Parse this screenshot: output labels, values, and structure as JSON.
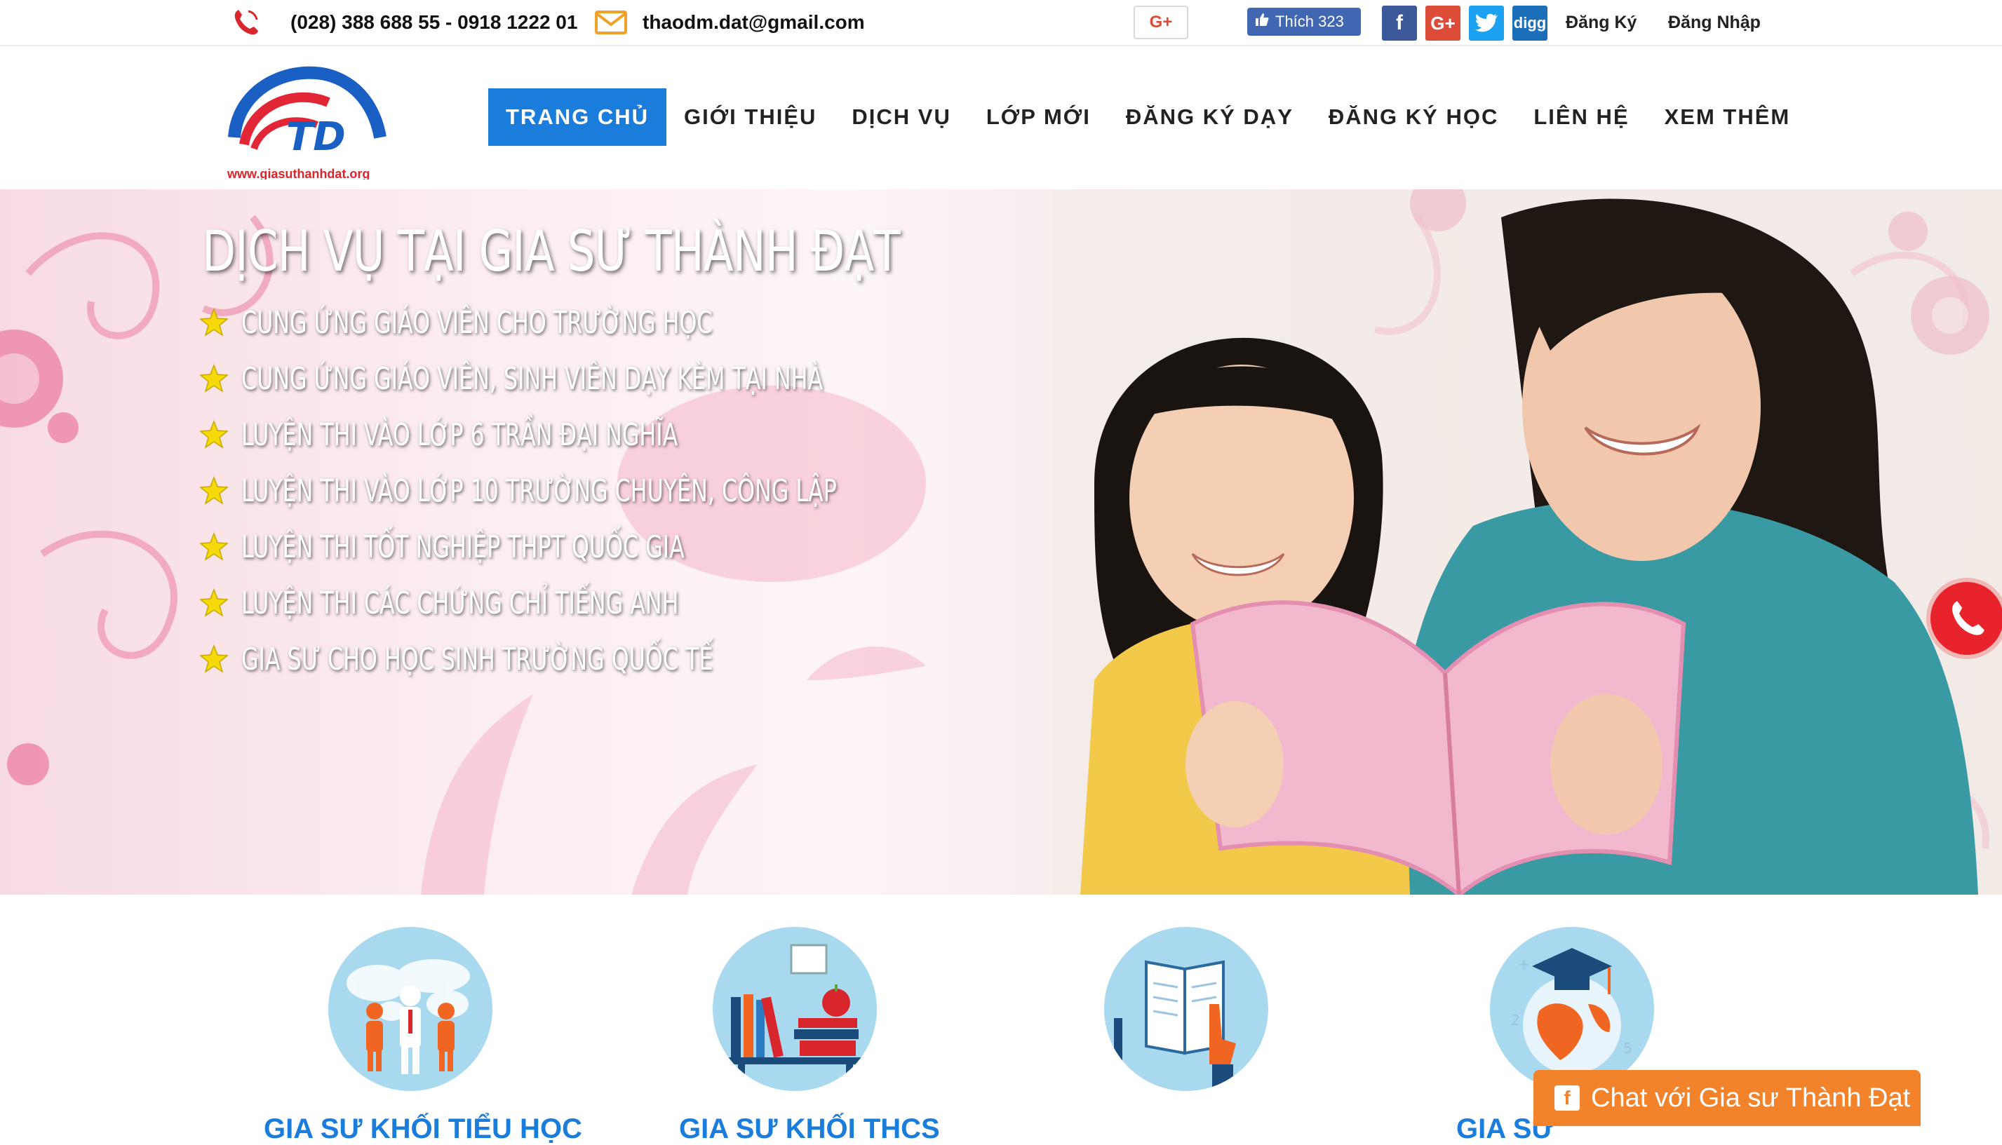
{
  "topbar": {
    "phone": "(028) 388 688 55 - 0918 1222 01",
    "email": "thaodm.dat@gmail.com",
    "gplus_label": "G+",
    "like_label": "Thích 323",
    "register": "Đăng Ký",
    "login": "Đăng Nhập",
    "social": [
      "facebook-icon",
      "google-plus-icon",
      "twitter-icon",
      "digg-icon"
    ]
  },
  "logo": {
    "initials": "TD",
    "url": "www.giasuthanhdat.org"
  },
  "nav": {
    "items": [
      "TRANG CHỦ",
      "GIỚI THIỆU",
      "DỊCH VỤ",
      "LỚP MỚI",
      "ĐĂNG KÝ DẠY",
      "ĐĂNG KÝ HỌC",
      "LIÊN HỆ",
      "XEM THÊM"
    ],
    "active_index": 0
  },
  "hero": {
    "title": "DỊCH VỤ TẠI GIA SƯ THÀNH ĐẠT",
    "items": [
      "CUNG ỨNG GIÁO VIÊN CHO TRƯỜNG HỌC",
      "CUNG ỨNG GIÁO VIÊN, SINH VIÊN DẠY KÈM TẠI NHÀ",
      "LUYỆN THI VÀO LỚP 6 TRẦN ĐẠI NGHĨA",
      "LUYỆN THI VÀO LỚP 10 TRƯỜNG CHUYÊN, CÔNG LẬP",
      "LUYỆN THI TỐT NGHIỆP THPT QUỐC GIA",
      "LUYỆN THI CÁC CHỨNG CHỈ TIẾNG ANH",
      "GIA SƯ CHO HỌC SINH TRƯỜNG QUỐC TẾ"
    ]
  },
  "services": {
    "labels": [
      "GIA SƯ KHỐI TIỂU HỌC",
      "GIA SƯ KHỐI THCS",
      "",
      "GIA SƯ"
    ]
  },
  "chat": {
    "label": "Chat với Gia sư Thành Đạt"
  },
  "colors": {
    "brand_blue": "#1a7ddb",
    "accent_orange": "#f3832a",
    "phone_red": "#e8232b",
    "star_yellow": "#f5d90a"
  }
}
